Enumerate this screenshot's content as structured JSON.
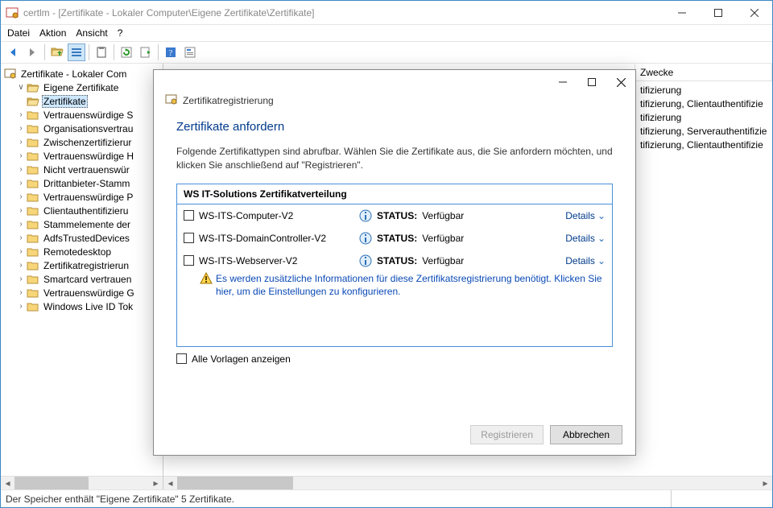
{
  "window": {
    "title": "certlm - [Zertifikate - Lokaler Computer\\Eigene Zertifikate\\Zertifikate]"
  },
  "menubar": {
    "items": [
      "Datei",
      "Aktion",
      "Ansicht",
      "?"
    ]
  },
  "tree": {
    "root": "Zertifikate - Lokaler Com",
    "expanded_parent": "Eigene Zertifikate",
    "selected_child": "Zertifikate",
    "siblings": [
      "Vertrauenswürdige S",
      "Organisationsvertrau",
      "Zwischenzertifizierur",
      "Vertrauenswürdige H",
      "Nicht vertrauenswür",
      "Drittanbieter-Stamm",
      "Vertrauenswürdige P",
      "Clientauthentifizieru",
      "Stammelemente der",
      "AdfsTrustedDevices",
      "Remotedesktop",
      "Zertifikatregistrierun",
      "Smartcard vertrauen",
      "Vertrauenswürdige G",
      "Windows Live ID Tok"
    ]
  },
  "list": {
    "col_purpose": "Zwecke",
    "rows_purpose": [
      "tifizierung",
      "tifizierung, Clientauthentifizie",
      "tifizierung",
      "tifizierung, Serverauthentifizie",
      "tifizierung, Clientauthentifizie"
    ]
  },
  "statusbar": {
    "text": "Der Speicher enthält \"Eigene Zertifikate\" 5 Zertifikate."
  },
  "dialog": {
    "header": "Zertifikatregistrierung",
    "title": "Zertifikate anfordern",
    "description": "Folgende Zertifikattypen sind abrufbar. Wählen Sie die Zertifikate aus, die Sie anfordern möchten, und klicken Sie anschließend auf \"Registrieren\".",
    "group": "WS IT-Solutions Zertifikatverteilung",
    "status_label": "STATUS:",
    "status_value": "Verfügbar",
    "details": "Details",
    "rows": [
      {
        "name": "WS-ITS-Computer-V2"
      },
      {
        "name": "WS-ITS-DomainController-V2"
      },
      {
        "name": "WS-ITS-Webserver-V2"
      }
    ],
    "info": "Es werden zusätzliche Informationen für diese Zertifikatsregistrierung benötigt. Klicken Sie hier, um die Einstellungen zu konfigurieren.",
    "show_all": "Alle Vorlagen anzeigen",
    "btn_register": "Registrieren",
    "btn_cancel": "Abbrechen"
  }
}
